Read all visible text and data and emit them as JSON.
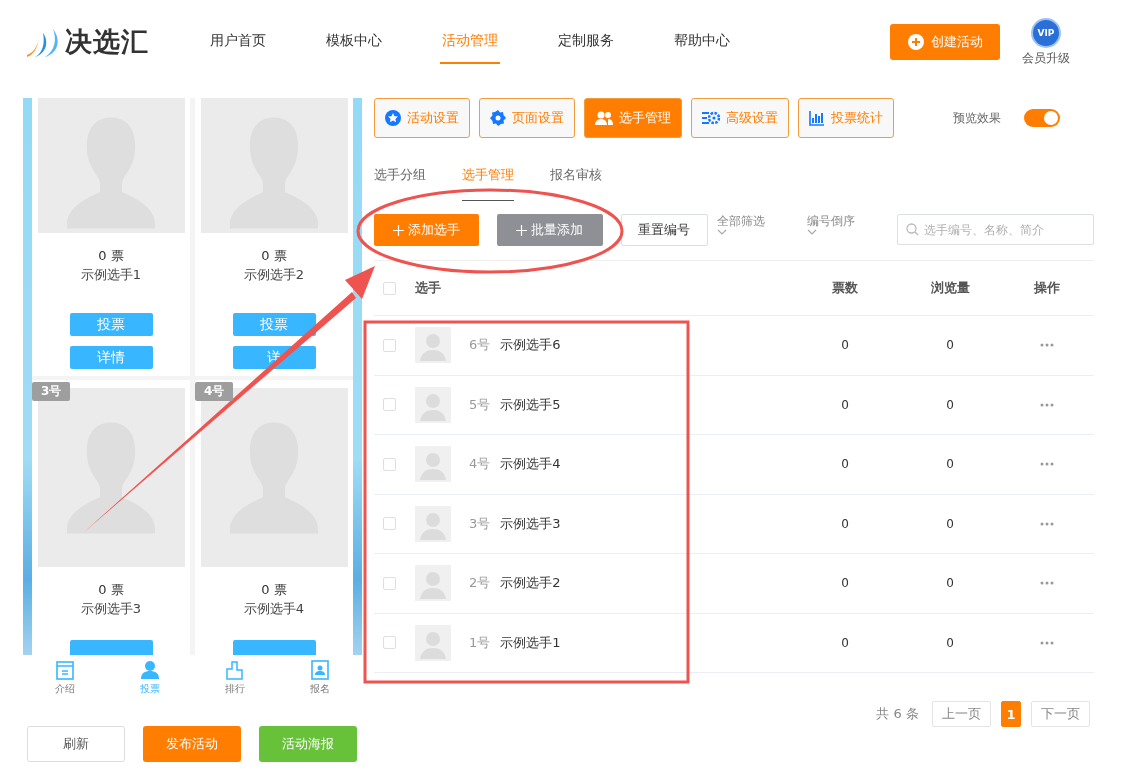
{
  "logo": {
    "text": "决选汇"
  },
  "nav": [
    {
      "label": "用户首页",
      "selected": false
    },
    {
      "label": "模板中心",
      "selected": false
    },
    {
      "label": "活动管理",
      "selected": true
    },
    {
      "label": "定制服务",
      "selected": false
    },
    {
      "label": "帮助中心",
      "selected": false
    }
  ],
  "create_button": "创建活动",
  "vip": {
    "badge": "VIP",
    "label": "会员升级"
  },
  "preview": {
    "cards": [
      {
        "kind": "full",
        "votes": "0 票",
        "name": "示例选手1",
        "buttons": [
          "投票",
          "详情"
        ]
      },
      {
        "kind": "full",
        "votes": "0 票",
        "name": "示例选手2",
        "buttons": [
          "投票",
          "详"
        ]
      },
      {
        "kind": "cut",
        "badge": "3号",
        "votes": "0 票",
        "name": "示例选手3"
      },
      {
        "kind": "cut",
        "badge": "4号",
        "votes": "0 票",
        "name": "示例选手4"
      }
    ],
    "tabbar": [
      {
        "label": "介绍",
        "selected": false
      },
      {
        "label": "投票",
        "selected": true
      },
      {
        "label": "排行",
        "selected": false
      },
      {
        "label": "报名",
        "selected": false
      }
    ]
  },
  "bottom_buttons": [
    {
      "label": "刷新",
      "kind": "plain"
    },
    {
      "label": "发布活动",
      "kind": "primary"
    },
    {
      "label": "活动海报",
      "kind": "success"
    }
  ],
  "toolbar": [
    {
      "label": "活动设置",
      "selected": false
    },
    {
      "label": "页面设置",
      "selected": false
    },
    {
      "label": "选手管理",
      "selected": true
    },
    {
      "label": "高级设置",
      "selected": false
    },
    {
      "label": "投票统计",
      "selected": false
    }
  ],
  "preview_toggle": {
    "label": "预览效果",
    "on": true
  },
  "subtabs": [
    {
      "label": "选手分组",
      "selected": false
    },
    {
      "label": "选手管理",
      "selected": true
    },
    {
      "label": "报名审核",
      "selected": false
    }
  ],
  "actions": {
    "add": "添加选手",
    "batch": "批量添加",
    "reset": "重置编号",
    "filters": [
      "全部筛选",
      "编号倒序"
    ],
    "search": {
      "placeholder": "选手编号、名称、简介"
    }
  },
  "table": {
    "select_all": {
      "checked": false
    },
    "columns": [
      "选手",
      "票数",
      "浏览量",
      "操作"
    ],
    "rows": [
      {
        "number": "6号",
        "name": "示例选手6",
        "votes": "0",
        "views": "0",
        "checked": false
      },
      {
        "number": "5号",
        "name": "示例选手5",
        "votes": "0",
        "views": "0",
        "checked": false
      },
      {
        "number": "4号",
        "name": "示例选手4",
        "votes": "0",
        "views": "0",
        "checked": false
      },
      {
        "number": "3号",
        "name": "示例选手3",
        "votes": "0",
        "views": "0",
        "checked": false
      },
      {
        "number": "2号",
        "name": "示例选手2",
        "votes": "0",
        "views": "0",
        "checked": false
      },
      {
        "number": "1号",
        "name": "示例选手1",
        "votes": "0",
        "views": "0",
        "checked": false
      }
    ]
  },
  "pagination": {
    "total": "共 6 条",
    "prev": "上一页",
    "pages": [
      {
        "label": "1",
        "selected": true
      }
    ],
    "next": "下一页"
  }
}
